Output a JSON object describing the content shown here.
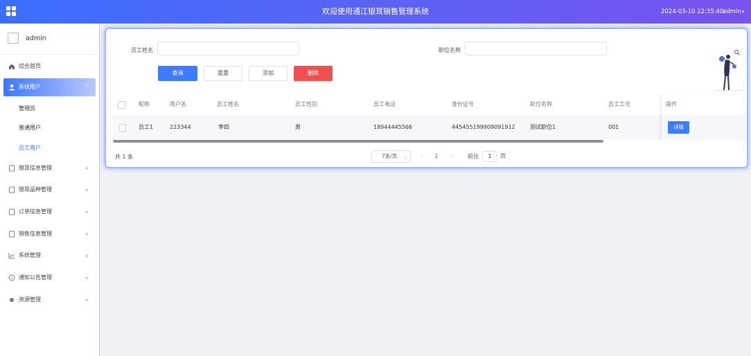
{
  "header": {
    "title": "欢迎使用通江银耳销售管理系统",
    "datetime": "2024-03-10 12:35:40",
    "user": "admin",
    "caret": "▾"
  },
  "sidebar": {
    "profile_name": "admin",
    "items": [
      {
        "label": "综合首页",
        "icon": "home-icon",
        "arrow": ""
      },
      {
        "label": "系统用户",
        "icon": "user-icon",
        "arrow": "^"
      },
      {
        "label": "银耳信息管理",
        "icon": "document-icon",
        "arrow": "v"
      },
      {
        "label": "银耳品种管理",
        "icon": "document-icon",
        "arrow": "v"
      },
      {
        "label": "订单信息管理",
        "icon": "document-icon",
        "arrow": "v"
      },
      {
        "label": "销售信息管理",
        "icon": "document-icon",
        "arrow": "v"
      },
      {
        "label": "系统管理",
        "icon": "chart-icon",
        "arrow": "v"
      },
      {
        "label": "通知公告管理",
        "icon": "info-icon",
        "arrow": "v"
      },
      {
        "label": "资源管理",
        "icon": "dot-icon",
        "arrow": "v"
      }
    ],
    "subitems": [
      "管理员",
      "普通用户",
      "员工用户"
    ]
  },
  "search": {
    "name_label": "员工姓名",
    "name_value": "",
    "position_label": "职位名称",
    "position_value": ""
  },
  "buttons": {
    "query": "查询",
    "reset": "重置",
    "add": "添加",
    "delete": "删除"
  },
  "table": {
    "columns": [
      "昵称",
      "用户名",
      "员工姓名",
      "员工性别",
      "员工电话",
      "身份证号",
      "职位名称",
      "员工工号",
      "操作"
    ],
    "rows": [
      {
        "nickname": "员工1",
        "username": "223344",
        "name": "李四",
        "gender": "男",
        "phone": "18944445566",
        "idcard": "445455199909091912",
        "position": "测试职位1",
        "number": "001",
        "action": "详情"
      }
    ]
  },
  "pagination": {
    "total": "共 1 条",
    "page_size": "7条/页",
    "page_size_caret": "⌄",
    "prev": "‹",
    "current_page": "1",
    "next": "›",
    "goto_prefix": "前往",
    "goto_value": "1",
    "goto_suffix": "页"
  }
}
